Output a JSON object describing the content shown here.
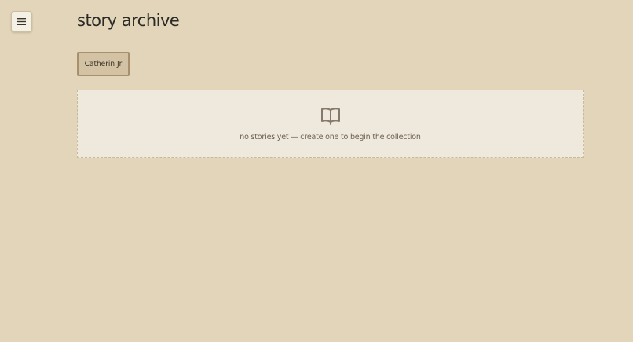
{
  "header": {
    "menu_icon": "hamburger-menu-icon",
    "title": "story archive"
  },
  "authors": {
    "tabs": [
      {
        "label": "Catherin Jr"
      }
    ]
  },
  "stories": {
    "empty_icon": "open-book-icon",
    "empty_message": "no stories yet — create one to begin the collection"
  },
  "colors": {
    "background": "#e2d5b9",
    "panel": "#efe8dc",
    "tab_bg": "#d3c3a4",
    "tab_border": "#a8906f"
  }
}
